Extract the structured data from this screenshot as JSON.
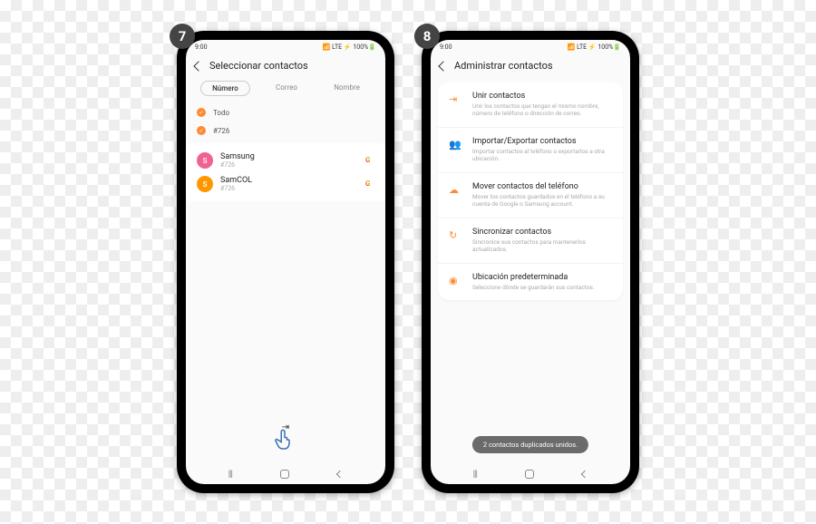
{
  "step_labels": {
    "left": "7",
    "right": "8"
  },
  "status": {
    "time": "9:00",
    "signals": "📶 LTE ⚡ 100%🔋"
  },
  "phone1": {
    "header_title": "Seleccionar contactos",
    "tabs": {
      "number": "Número",
      "email": "Correo",
      "name": "Nombre"
    },
    "select_all": "Todo",
    "group_label": "#726",
    "contacts": [
      {
        "initial": "S",
        "name": "Samsung",
        "sub": "#726"
      },
      {
        "initial": "S",
        "name": "SamCOL",
        "sub": "#726"
      }
    ]
  },
  "phone2": {
    "header_title": "Administrar contactos",
    "items": [
      {
        "icon": "⇥",
        "title": "Unir contactos",
        "desc": "Unir los contactos que tengan el mismo nombre, número de teléfono o dirección de correo."
      },
      {
        "icon": "👥",
        "title": "Importar/Exportar contactos",
        "desc": "Importar contactos al teléfono o exportarlos a otra ubicación."
      },
      {
        "icon": "☁",
        "title": "Mover contactos del teléfono",
        "desc": "Mover los contactos guardados en el teléfono a su cuenta de Google o Samsung account."
      },
      {
        "icon": "↻",
        "title": "Sincronizar contactos",
        "desc": "Sincronice sus contactos para mantenerlos actualizados."
      },
      {
        "icon": "◉",
        "title": "Ubicación predeterminada",
        "desc": "Seleccione dónde se guardarán sus contactos."
      }
    ],
    "toast": "2 contactos duplicados unidos."
  },
  "nav": {
    "recent": "|||"
  }
}
